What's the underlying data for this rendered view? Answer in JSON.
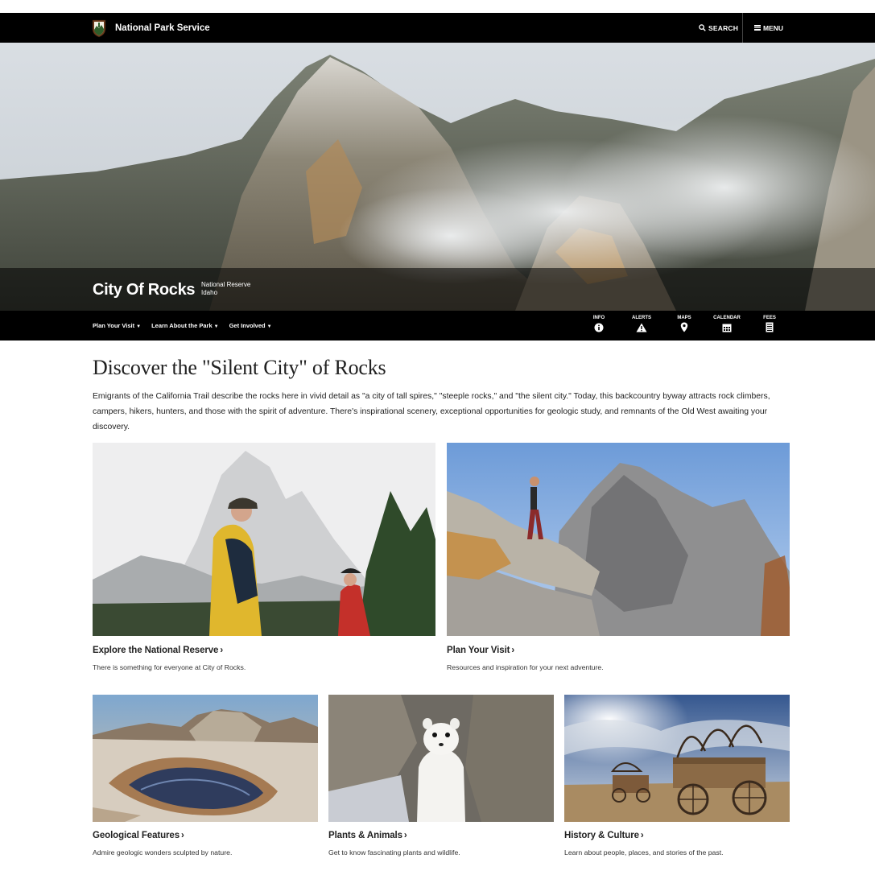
{
  "header": {
    "brand": "National Park Service",
    "search_label": "SEARCH",
    "menu_label": "MENU"
  },
  "park": {
    "title": "City Of Rocks",
    "designation": "National Reserve",
    "state": "Idaho"
  },
  "subnav": {
    "links": [
      "Plan Your Visit",
      "Learn About the Park",
      "Get Involved"
    ],
    "quick": [
      {
        "label": "INFO",
        "icon": "info-icon"
      },
      {
        "label": "ALERTS",
        "icon": "alert-triangle-icon"
      },
      {
        "label": "MAPS",
        "icon": "map-pin-icon"
      },
      {
        "label": "CALENDAR",
        "icon": "calendar-icon"
      },
      {
        "label": "FEES",
        "icon": "fees-icon"
      }
    ]
  },
  "main": {
    "headline": "Discover the \"Silent City\" of Rocks",
    "intro": "Emigrants of the California Trail describe the rocks here in vivid detail as \"a city of tall spires,\" \"steeple rocks,\" and \"the silent city.\" Today, this backcountry byway attracts rock climbers, campers, hikers, hunters, and those with the spirit of adventure. There's inspirational scenery, exceptional opportunities for geologic study, and remnants of the Old West awaiting your discovery."
  },
  "cards": [
    {
      "title": "Explore the National Reserve",
      "desc": "There is something for everyone at City of Rocks."
    },
    {
      "title": "Plan Your Visit",
      "desc": "Resources and inspiration for your next adventure."
    },
    {
      "title": "Geological Features",
      "desc": "Admire geologic wonders sculpted by nature."
    },
    {
      "title": "Plants & Animals",
      "desc": "Get to know fascinating plants and wildlife."
    },
    {
      "title": "History & Culture",
      "desc": "Learn about people, places, and stories of the past."
    }
  ],
  "colors": {
    "bar": "#000000",
    "text": "#212121"
  }
}
